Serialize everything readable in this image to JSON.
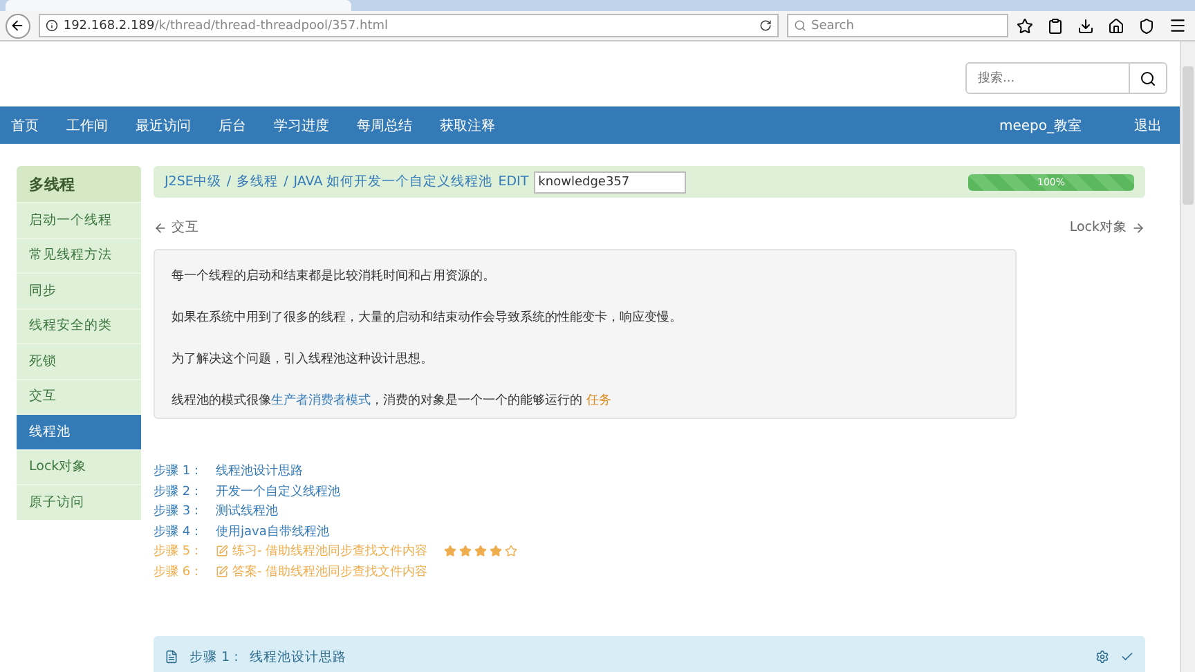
{
  "browser": {
    "url_host": "192.168.2.189",
    "url_path": "/k/thread/thread-threadpool/357.html",
    "search_placeholder": "Search"
  },
  "site_search": {
    "placeholder": "搜索..."
  },
  "nav": {
    "items": [
      {
        "label": "首页"
      },
      {
        "label": "工作间"
      },
      {
        "label": "最近访问"
      },
      {
        "label": "后台"
      },
      {
        "label": "学习进度"
      },
      {
        "label": "每周总结"
      },
      {
        "label": "获取注释"
      }
    ],
    "user": "meepo_教室",
    "logout": "退出"
  },
  "sidebar": {
    "title": "多线程",
    "items": [
      {
        "label": "启动一个线程",
        "selected": false
      },
      {
        "label": "常见线程方法",
        "selected": false
      },
      {
        "label": "同步",
        "selected": false
      },
      {
        "label": "线程安全的类",
        "selected": false
      },
      {
        "label": "死锁",
        "selected": false
      },
      {
        "label": "交互",
        "selected": false
      },
      {
        "label": "线程池",
        "selected": true
      },
      {
        "label": "Lock对象",
        "selected": false
      },
      {
        "label": "原子访问",
        "selected": false
      }
    ]
  },
  "breadcrumb": {
    "items": [
      "J2SE中级",
      "多线程"
    ],
    "separator": "/",
    "current": "JAVA 如何开发一个自定义线程池",
    "edit": "EDIT",
    "field_value": "knowledge357"
  },
  "progress": {
    "level": 1,
    "label": "100%"
  },
  "prev_link": "交互",
  "next_link": "Lock对象",
  "intro": [
    "每一个线程的启动和结束都是比较消耗时间和占用资源的。",
    "如果在系统中用到了很多的线程，大量的启动和结束动作会导致系统的性能变卡，响应变慢。",
    "为了解决这个问题，引入线程池这种设计思想。"
  ],
  "intro_last": {
    "before": "线程池的模式很像",
    "link": "生产者消费者模式",
    "middle": "，消费的对象是一个一个的能够运行的",
    "highlight": "任务"
  },
  "steps": [
    {
      "kind": "lesson",
      "label": "步骤 1 :",
      "title": "线程池设计思路"
    },
    {
      "kind": "lesson",
      "label": "步骤 2 :",
      "title": "开发一个自定义线程池"
    },
    {
      "kind": "lesson",
      "label": "步骤 3 :",
      "title": "测试线程池"
    },
    {
      "kind": "lesson",
      "label": "步骤 4 :",
      "title": "使用java自带线程池"
    },
    {
      "kind": "exercise",
      "label": "步骤 5 :",
      "title": "练习- 借助线程池同步查找文件内容",
      "stars": 4
    },
    {
      "kind": "exercise",
      "label": "步骤 6 :",
      "title": "答案- 借助线程池同步查找文件内容"
    }
  ],
  "step_panel": {
    "label": "步骤 1 :",
    "title": "线程池设计思路"
  }
}
